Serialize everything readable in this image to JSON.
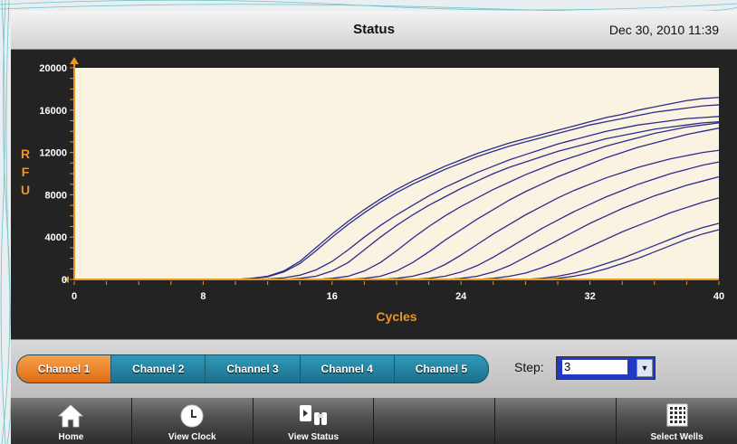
{
  "header": {
    "title": "Status",
    "datetime": "Dec 30, 2010 11:39"
  },
  "chart_data": {
    "type": "line",
    "xlabel": "Cycles",
    "ylabel": "R F U",
    "xlim": [
      0,
      40
    ],
    "ylim": [
      0,
      20000
    ],
    "x_ticks": [
      0,
      8,
      16,
      24,
      32,
      40
    ],
    "y_ticks": [
      0,
      4000,
      8000,
      12000,
      16000,
      20000
    ],
    "x": [
      1,
      2,
      3,
      4,
      5,
      6,
      7,
      8,
      9,
      10,
      11,
      12,
      13,
      14,
      15,
      16,
      17,
      18,
      19,
      20,
      21,
      22,
      23,
      24,
      25,
      26,
      27,
      28,
      29,
      30,
      31,
      32,
      33,
      34,
      35,
      36,
      37,
      38,
      39,
      40
    ],
    "series": [
      {
        "values": [
          0,
          0,
          0,
          0,
          0,
          0,
          0,
          0,
          0,
          0,
          100,
          300,
          800,
          1700,
          3000,
          4300,
          5500,
          6600,
          7600,
          8500,
          9300,
          10000,
          10700,
          11300,
          11900,
          12400,
          12900,
          13300,
          13700,
          14100,
          14500,
          14900,
          15300,
          15600,
          16000,
          16300,
          16600,
          16900,
          17100,
          17200
        ]
      },
      {
        "values": [
          0,
          0,
          0,
          0,
          0,
          0,
          0,
          0,
          0,
          0,
          80,
          250,
          700,
          1500,
          2700,
          4000,
          5200,
          6300,
          7300,
          8200,
          9000,
          9700,
          10400,
          11000,
          11600,
          12100,
          12600,
          13000,
          13400,
          13800,
          14200,
          14600,
          14900,
          15200,
          15500,
          15800,
          16000,
          16200,
          16400,
          16500
        ]
      },
      {
        "values": [
          0,
          0,
          0,
          0,
          0,
          0,
          0,
          0,
          0,
          0,
          0,
          50,
          150,
          400,
          900,
          1700,
          2800,
          4000,
          5100,
          6100,
          7000,
          7900,
          8700,
          9400,
          10100,
          10700,
          11300,
          11800,
          12300,
          12800,
          13200,
          13600,
          14000,
          14300,
          14600,
          14800,
          15000,
          15200,
          15300,
          15400
        ]
      },
      {
        "values": [
          0,
          0,
          0,
          0,
          0,
          0,
          0,
          0,
          0,
          0,
          0,
          0,
          0,
          100,
          300,
          800,
          1600,
          2800,
          4000,
          5100,
          6100,
          7000,
          7800,
          8600,
          9300,
          10000,
          10600,
          11100,
          11600,
          12100,
          12500,
          12900,
          13300,
          13600,
          13900,
          14200,
          14400,
          14600,
          14800,
          14900
        ]
      },
      {
        "values": [
          0,
          0,
          0,
          0,
          0,
          0,
          0,
          0,
          0,
          0,
          0,
          0,
          0,
          0,
          0,
          100,
          300,
          800,
          1600,
          2700,
          3900,
          5000,
          6000,
          6900,
          7700,
          8500,
          9200,
          9900,
          10500,
          11100,
          11600,
          12100,
          12600,
          13000,
          13400,
          13800,
          14100,
          14400,
          14600,
          14800
        ]
      },
      {
        "values": [
          0,
          0,
          0,
          0,
          0,
          0,
          0,
          0,
          0,
          0,
          0,
          0,
          0,
          0,
          0,
          0,
          0,
          100,
          300,
          800,
          1600,
          2600,
          3700,
          4700,
          5700,
          6600,
          7500,
          8300,
          9000,
          9700,
          10300,
          10900,
          11500,
          12000,
          12500,
          12900,
          13300,
          13700,
          14000,
          14300
        ]
      },
      {
        "values": [
          0,
          0,
          0,
          0,
          0,
          0,
          0,
          0,
          0,
          0,
          0,
          0,
          0,
          0,
          0,
          0,
          0,
          0,
          0,
          100,
          300,
          700,
          1400,
          2300,
          3300,
          4300,
          5200,
          6100,
          6900,
          7700,
          8400,
          9000,
          9600,
          10100,
          10600,
          11000,
          11400,
          11700,
          12000,
          12200
        ]
      },
      {
        "values": [
          0,
          0,
          0,
          0,
          0,
          0,
          0,
          0,
          0,
          0,
          0,
          0,
          0,
          0,
          0,
          0,
          0,
          0,
          0,
          0,
          0,
          100,
          300,
          700,
          1300,
          2100,
          3000,
          3900,
          4800,
          5600,
          6400,
          7100,
          7800,
          8400,
          9000,
          9500,
          10000,
          10400,
          10800,
          11100
        ]
      },
      {
        "values": [
          0,
          0,
          0,
          0,
          0,
          0,
          0,
          0,
          0,
          0,
          0,
          0,
          0,
          0,
          0,
          0,
          0,
          0,
          0,
          0,
          0,
          0,
          0,
          100,
          300,
          700,
          1300,
          2100,
          2900,
          3700,
          4500,
          5300,
          6000,
          6700,
          7300,
          7900,
          8400,
          8900,
          9300,
          9700
        ]
      },
      {
        "values": [
          0,
          0,
          0,
          0,
          0,
          0,
          0,
          0,
          0,
          0,
          0,
          0,
          0,
          0,
          0,
          0,
          0,
          0,
          0,
          0,
          0,
          0,
          0,
          0,
          0,
          100,
          300,
          600,
          1100,
          1700,
          2400,
          3100,
          3800,
          4500,
          5100,
          5700,
          6300,
          6800,
          7300,
          7700
        ]
      },
      {
        "values": [
          0,
          0,
          0,
          0,
          0,
          0,
          0,
          0,
          0,
          0,
          0,
          0,
          0,
          0,
          0,
          0,
          0,
          0,
          0,
          0,
          0,
          0,
          0,
          0,
          0,
          0,
          0,
          0,
          100,
          300,
          600,
          1000,
          1500,
          2000,
          2600,
          3200,
          3800,
          4400,
          4900,
          5300
        ]
      },
      {
        "values": [
          0,
          0,
          0,
          0,
          0,
          0,
          0,
          0,
          0,
          0,
          0,
          0,
          0,
          0,
          0,
          0,
          0,
          0,
          0,
          0,
          0,
          0,
          0,
          0,
          0,
          0,
          0,
          0,
          0,
          100,
          300,
          600,
          1000,
          1500,
          2000,
          2600,
          3200,
          3800,
          4300,
          4700
        ]
      }
    ],
    "line_color": "#2c2c8a",
    "plot_background": "#fbf3e2",
    "axis_color": "#e8952a",
    "grid": false
  },
  "controls": {
    "channels": [
      {
        "label": "Channel 1",
        "active": true
      },
      {
        "label": "Channel 2",
        "active": false
      },
      {
        "label": "Channel 3",
        "active": false
      },
      {
        "label": "Channel 4",
        "active": false
      },
      {
        "label": "Channel 5",
        "active": false
      }
    ],
    "step_label": "Step:",
    "step_value": "3"
  },
  "toolbar": {
    "buttons": [
      {
        "label": "Home",
        "icon": "home-icon"
      },
      {
        "label": "View Clock",
        "icon": "clock-icon"
      },
      {
        "label": "View Status",
        "icon": "binoculars-icon"
      },
      {
        "label": "",
        "icon": ""
      },
      {
        "label": "",
        "icon": ""
      },
      {
        "label": "Select Wells",
        "icon": "grid-icon"
      }
    ]
  },
  "colors": {
    "accent_orange": "#e8952a",
    "channel_teal": "#2f9bb9",
    "step_select_blue": "#1f3bc6"
  }
}
